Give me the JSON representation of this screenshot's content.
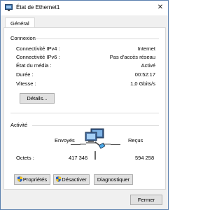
{
  "window": {
    "title": "État de Ethernet1",
    "close_symbol": "✕"
  },
  "tabs": [
    {
      "label": "Général"
    }
  ],
  "connexion": {
    "heading": "Connexion",
    "rows": [
      {
        "label": "Connectivité IPv4 :",
        "value": "Internet"
      },
      {
        "label": "Connectivité IPv6 :",
        "value": "Pas d'accès réseau"
      },
      {
        "label": "État du média :",
        "value": "Activé"
      },
      {
        "label": "Durée :",
        "value": "00:52:17"
      },
      {
        "label": "Vitesse :",
        "value": "1,0 Gbits/s"
      }
    ],
    "details_button": "Détails..."
  },
  "activite": {
    "heading": "Activité",
    "sent_label": "Envoyés",
    "received_label": "Reçus",
    "octets_label": "Octets :",
    "octets_sent": "417 346",
    "octets_received": "594 258"
  },
  "buttons": {
    "properties": "Propriétés",
    "disable": "Désactiver",
    "diagnose": "Diagnostiquer",
    "close": "Fermer"
  },
  "icons": {
    "app": "network-adapter-icon",
    "shield": "uac-shield-icon",
    "activity": "network-activity-icon"
  },
  "colors": {
    "accent": "#5a7fae",
    "button_bg": "#e1e1e1",
    "button_border": "#adadad"
  }
}
